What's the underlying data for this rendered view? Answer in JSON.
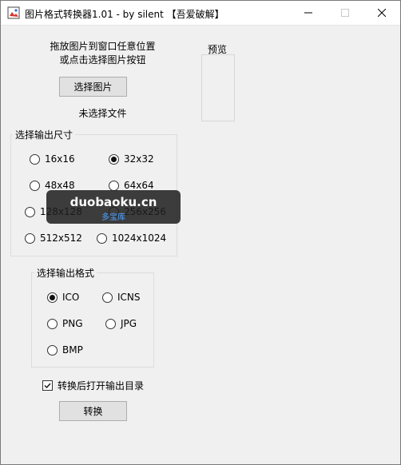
{
  "titlebar": {
    "title": "图片格式转换器1.01 - by silent 【吾爱破解】"
  },
  "instructions": {
    "line1": "拖放图片到窗口任意位置",
    "line2": "或点击选择图片按钮"
  },
  "select_button_label": "选择图片",
  "file_status": "未选择文件",
  "preview_label": "预览",
  "size_group": {
    "title": "选择输出尺寸",
    "options": [
      "16x16",
      "32x32",
      "48x48",
      "64x64",
      "128x128",
      "256x256",
      "512x512",
      "1024x1024"
    ],
    "selected": "32x32"
  },
  "format_group": {
    "title": "选择输出格式",
    "options": [
      "ICO",
      "ICNS",
      "PNG",
      "JPG",
      "BMP"
    ],
    "selected": "ICO"
  },
  "open_after": {
    "label": "转换后打开输出目录",
    "checked": true
  },
  "convert_button_label": "转换",
  "watermark": {
    "main": "duobaoku.cn",
    "sub": "多宝库"
  }
}
